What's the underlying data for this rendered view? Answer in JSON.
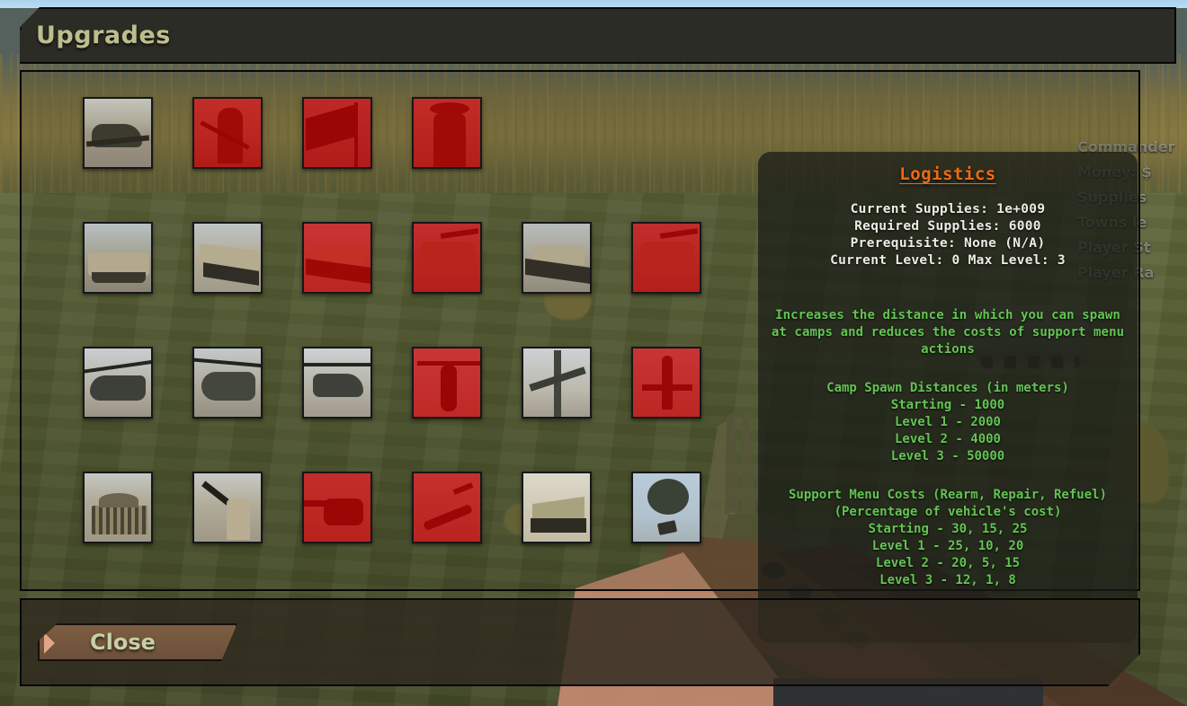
{
  "window": {
    "title": "Upgrades",
    "close_label": "Close"
  },
  "hud": {
    "lines": [
      "Commander",
      "Money: $",
      "Supplies",
      "Towns le",
      "Player St",
      "Player Ra"
    ]
  },
  "info_panel": {
    "title": "Logistics",
    "stats": [
      "Current Supplies: 1e+009",
      "Required Supplies: 6000",
      "Prerequisite: None (N/A)",
      "Current Level: 0    Max Level: 3"
    ],
    "description": "Increases the distance in which you can spawn at camps and reduces the costs of support menu actions",
    "sections": [
      {
        "heading": "Camp Spawn Distances (in meters)",
        "subheading": "",
        "rows": [
          "Starting - 1000",
          "Level 1 - 2000",
          "Level 2 - 4000",
          "Level 3 - 50000"
        ]
      },
      {
        "heading": "Support Menu Costs (Rearm, Repair, Refuel)",
        "subheading": "(Percentage of vehicle's cost)",
        "rows": [
          "Starting - 30, 15, 25",
          "Level 1 - 25, 10, 20",
          "Level 2 - 20, 5, 15",
          "Level 3 - 12, 1, 8"
        ]
      }
    ]
  },
  "colors": {
    "title_text": "#bdbd8e",
    "panel_title": "#ee6a11",
    "stat_text": "#eceee6",
    "desc_text": "#63c453",
    "locked_overlay": "#d60808",
    "close_button": "#7d5e42"
  },
  "grid": {
    "rows": [
      {
        "slots": [
          {
            "name": "infantry-prone-upgrade",
            "art": "art-soldier-prone",
            "locked": false
          },
          {
            "name": "infantry-rifleman-upgrade",
            "art": "art-soldier-stand",
            "locked": true
          },
          {
            "name": "flag-banner-upgrade",
            "art": "art-flag",
            "locked": true
          },
          {
            "name": "infantry-heavy-upgrade",
            "art": "art-soldier-hat",
            "locked": true
          }
        ]
      },
      {
        "slots": [
          {
            "name": "humvee-upgrade",
            "art": "art-humvee",
            "locked": false
          },
          {
            "name": "apc-upgrade",
            "art": "art-apc",
            "locked": false
          },
          {
            "name": "light-tank-upgrade",
            "art": "art-tank",
            "locked": true
          },
          {
            "name": "medium-tank-upgrade",
            "art": "art-tank2",
            "locked": true
          },
          {
            "name": "main-tank-upgrade",
            "art": "art-tank",
            "locked": false
          },
          {
            "name": "heavy-tank-upgrade",
            "art": "art-tank2",
            "locked": true
          }
        ]
      },
      {
        "slots": [
          {
            "name": "transport-helicopter-upgrade",
            "art": "art-heli",
            "locked": false
          },
          {
            "name": "utility-helicopter-upgrade",
            "art": "art-heli2",
            "locked": false
          },
          {
            "name": "scout-helicopter-upgrade",
            "art": "art-heli3",
            "locked": false
          },
          {
            "name": "attack-helicopter-upgrade",
            "art": "art-heli-front",
            "locked": true
          },
          {
            "name": "fighter-jet-upgrade",
            "art": "art-jet",
            "locked": false
          },
          {
            "name": "bomber-jet-upgrade",
            "art": "art-jet2",
            "locked": true
          }
        ]
      },
      {
        "slots": [
          {
            "name": "supplies-upgrade",
            "art": "art-supplies",
            "locked": false
          },
          {
            "name": "mortar-upgrade",
            "art": "art-mortar",
            "locked": false
          },
          {
            "name": "artillery-upgrade",
            "art": "art-artillery",
            "locked": true
          },
          {
            "name": "airstrike-upgrade",
            "art": "art-airstrike",
            "locked": true
          },
          {
            "name": "bunker-upgrade",
            "art": "art-bunker",
            "locked": false
          },
          {
            "name": "airdrop-upgrade",
            "art": "art-airdrop",
            "locked": false
          }
        ]
      }
    ]
  }
}
